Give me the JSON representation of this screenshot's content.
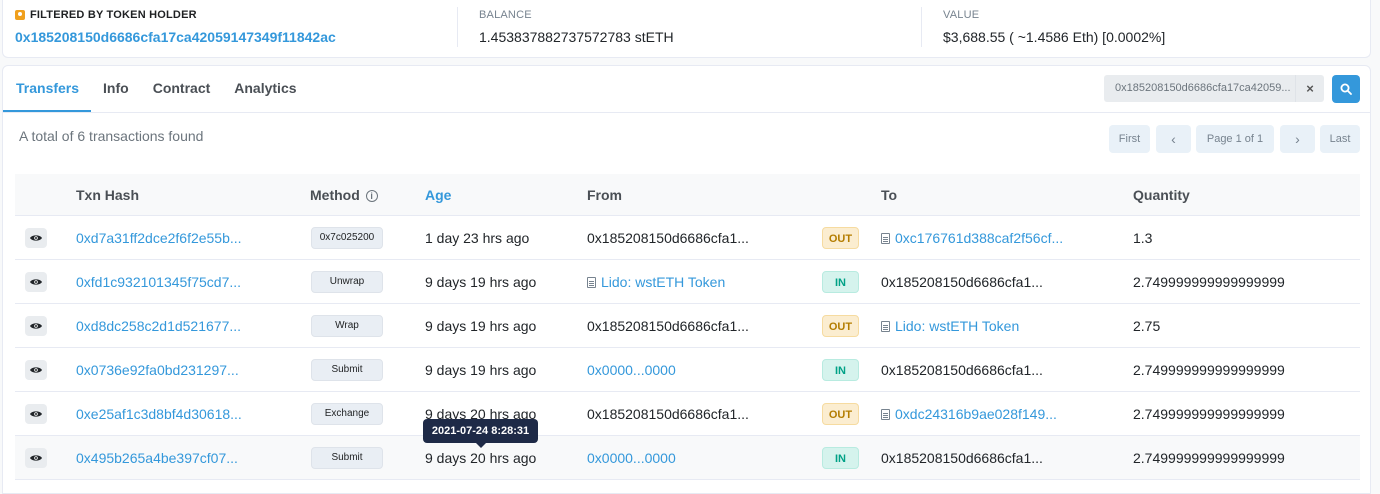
{
  "summary": {
    "filtered_label": "FILTERED BY TOKEN HOLDER",
    "holder_address": "0x185208150d6686cfa17ca42059147349f11842ac",
    "balance_label": "BALANCE",
    "balance_value": "1.453837882737572783 stETH",
    "value_label": "VALUE",
    "value_value": "$3,688.55 ( ~1.4586 Eth) [0.0002%]"
  },
  "tabs": [
    {
      "label": "Transfers",
      "active": true
    },
    {
      "label": "Info",
      "active": false
    },
    {
      "label": "Contract",
      "active": false
    },
    {
      "label": "Analytics",
      "active": false
    }
  ],
  "search": {
    "value": "0x185208150d6686cfa17ca42059...",
    "clear_glyph": "×"
  },
  "total_text": "A total of 6 transactions found",
  "pager": {
    "first": "First",
    "prev": "‹",
    "page": "Page 1 of 1",
    "next": "›",
    "last": "Last"
  },
  "columns": {
    "txn_hash": "Txn Hash",
    "method": "Method",
    "age": "Age",
    "from": "From",
    "to": "To",
    "quantity": "Quantity"
  },
  "rows": [
    {
      "hash": "0xd7a31ff2dce2f6f2e55b...",
      "method": "0x7c025200",
      "age": "1 day 23 hrs ago",
      "from": "0x185208150d6686cfa1...",
      "from_link": false,
      "from_doc": false,
      "direction": "OUT",
      "to": "0xc176761d388caf2f56cf...",
      "to_link": true,
      "to_doc": true,
      "quantity": "1.3"
    },
    {
      "hash": "0xfd1c932101345f75cd7...",
      "method": "Unwrap",
      "age": "9 days 19 hrs ago",
      "from": "Lido: wstETH Token",
      "from_link": true,
      "from_doc": true,
      "direction": "IN",
      "to": "0x185208150d6686cfa1...",
      "to_link": false,
      "to_doc": false,
      "quantity": "2.749999999999999999"
    },
    {
      "hash": "0xd8dc258c2d1d521677...",
      "method": "Wrap",
      "age": "9 days 19 hrs ago",
      "from": "0x185208150d6686cfa1...",
      "from_link": false,
      "from_doc": false,
      "direction": "OUT",
      "to": "Lido: wstETH Token",
      "to_link": true,
      "to_doc": true,
      "quantity": "2.75"
    },
    {
      "hash": "0x0736e92fa0bd231297...",
      "method": "Submit",
      "age": "9 days 19 hrs ago",
      "from": "0x0000...0000",
      "from_link": true,
      "from_doc": false,
      "direction": "IN",
      "to": "0x185208150d6686cfa1...",
      "to_link": false,
      "to_doc": false,
      "quantity": "2.749999999999999999"
    },
    {
      "hash": "0xe25af1c3d8bf4d30618...",
      "method": "Exchange",
      "age": "9 days 20 hrs ago",
      "from": "0x185208150d6686cfa1...",
      "from_link": false,
      "from_doc": false,
      "direction": "OUT",
      "to": "0xdc24316b9ae028f149...",
      "to_link": true,
      "to_doc": true,
      "quantity": "2.749999999999999999"
    },
    {
      "hash": "0x495b265a4be397cf07...",
      "method": "Submit",
      "age": "9 days 20 hrs ago",
      "from": "0x0000...0000",
      "from_link": true,
      "from_doc": false,
      "direction": "IN",
      "to": "0x185208150d6686cfa1...",
      "to_link": false,
      "to_doc": false,
      "quantity": "2.749999999999999999"
    }
  ],
  "tooltip": "2021-07-24 8:28:31",
  "colors": {
    "accent": "#3498db",
    "out_badge": "#fbedd0",
    "in_badge": "#d5f3ed"
  }
}
